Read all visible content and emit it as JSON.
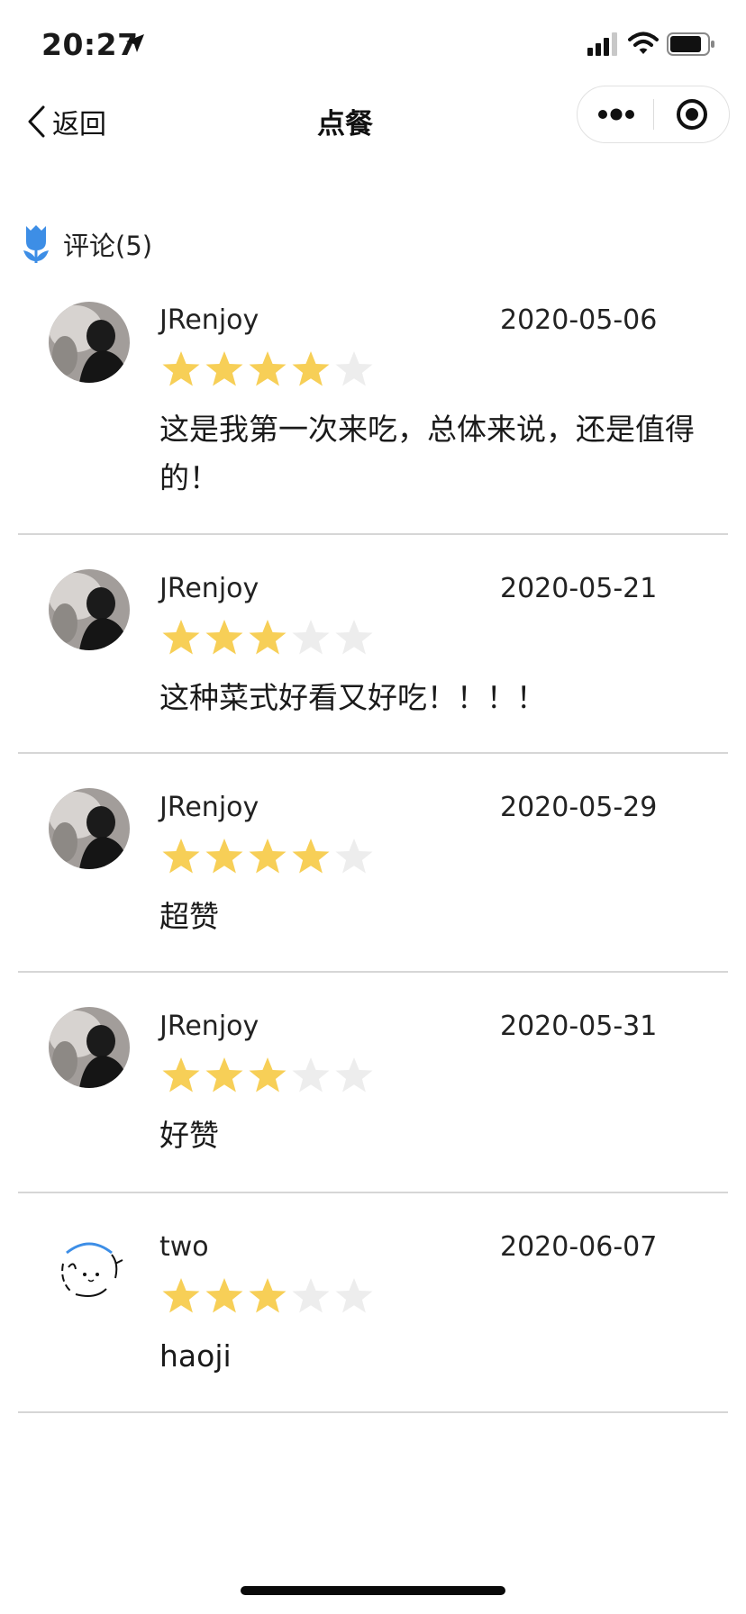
{
  "status_bar": {
    "time": "20:27"
  },
  "nav": {
    "back_label": "返回",
    "title": "点餐"
  },
  "comments": {
    "title": "评论(5)",
    "items": [
      {
        "user": "JRenjoy",
        "date": "2020-05-06",
        "rating": 4,
        "text": "这是我第一次来吃，总体来说，还是值得的！",
        "avatar": "photo"
      },
      {
        "user": "JRenjoy",
        "date": "2020-05-21",
        "rating": 3,
        "text": "这种菜式好看又好吃！！！！",
        "avatar": "photo"
      },
      {
        "user": "JRenjoy",
        "date": "2020-05-29",
        "rating": 4,
        "text": "超赞",
        "avatar": "photo"
      },
      {
        "user": "JRenjoy",
        "date": "2020-05-31",
        "rating": 3,
        "text": "好赞",
        "avatar": "photo"
      },
      {
        "user": "two",
        "date": "2020-06-07",
        "rating": 3,
        "text": "haoji",
        "avatar": "cartoon"
      }
    ]
  },
  "colors": {
    "star_on": "#f7cf57",
    "star_off": "#ededed",
    "accent": "#3d8ee6"
  },
  "icons": {
    "back": "chevron-left-icon",
    "more": "more-dots-icon",
    "close": "target-icon",
    "comments": "tulip-icon",
    "rating": "star-icon"
  }
}
